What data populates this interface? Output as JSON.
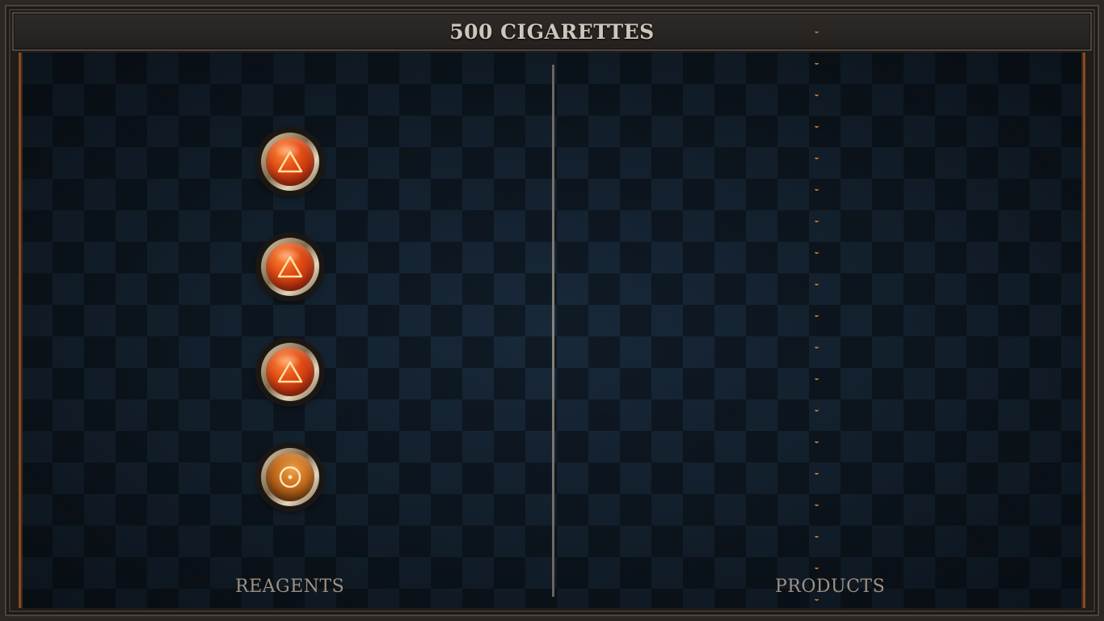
{
  "header": {
    "title": "500 CIGARETTES"
  },
  "reagents": {
    "label": "REAGENTS",
    "items": [
      {
        "icon": "fire-triangle-icon",
        "color": "#e04a12"
      },
      {
        "icon": "fire-triangle-icon",
        "color": "#e04a12"
      },
      {
        "icon": "fire-triangle-icon",
        "color": "#e04a12"
      },
      {
        "icon": "circled-dot-icon",
        "color": "#c66d1d"
      }
    ]
  },
  "products": {
    "label": "PRODUCTS",
    "items": []
  },
  "colors": {
    "accent_copper": "#8a4a20",
    "title_text": "#cfc6bb",
    "label_text": "#9e9184",
    "panel_bg": "#0f1922"
  }
}
